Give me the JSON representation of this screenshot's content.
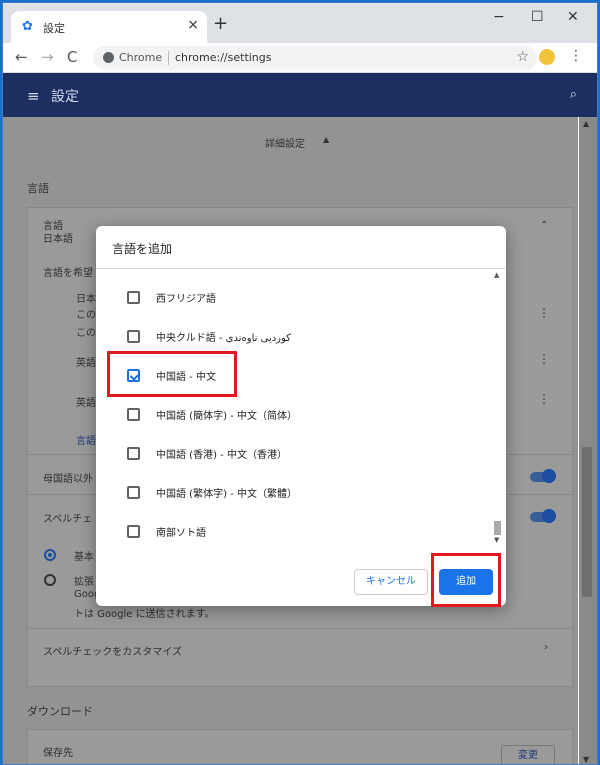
{
  "tab": {
    "title": "設定",
    "close": "×"
  },
  "toolbar": {
    "back": "←",
    "forward": "→",
    "reload": "C",
    "chrome_label": "Chrome",
    "url": "chrome://settings",
    "new_tab": "+",
    "minimize": "−",
    "maximize": "☐",
    "close": "✕"
  },
  "header": {
    "menu_icon": "≡",
    "title": "設定",
    "search_icon": "🔍"
  },
  "settings": {
    "advanced": "詳細設定",
    "advanced_caret": "▲",
    "languages_section": "言語",
    "lang_title": "言語",
    "lang_value": "日本語",
    "order_label": "言語を希望",
    "row1a": "日本",
    "row1b": "この",
    "row1c": "この",
    "row2": "英語",
    "row3": "英語",
    "add_languages": "言語",
    "translate_offer": "母国語以外",
    "spellcheck": "スペルチェ",
    "basic": "基本",
    "enhanced": "拡張",
    "enhanced_desc1": "Googl",
    "enhanced_desc2": "トは Google に送信されます。",
    "customize_spellcheck": "スペルチェックをカスタマイズ",
    "downloads_section": "ダウンロード",
    "save_location": "保存先",
    "change": "変更",
    "chevron": "›",
    "collapse": "⌃"
  },
  "dialog": {
    "title": "言語を追加",
    "languages": [
      {
        "label": "西フリジア語",
        "checked": false
      },
      {
        "label": "中央クルド語 - کوردیی ناوەندی",
        "checked": false
      },
      {
        "label": "中国語 - 中文",
        "checked": true
      },
      {
        "label": "中国語 (簡体字) - 中文（简体）",
        "checked": false
      },
      {
        "label": "中国語 (香港) - 中文（香港）",
        "checked": false
      },
      {
        "label": "中国語 (繁体字) - 中文（繁體）",
        "checked": false
      },
      {
        "label": "南部ソト語",
        "checked": false
      }
    ],
    "cancel": "キャンセル",
    "add": "追加",
    "scroll_up": "▲",
    "scroll_down": "▼"
  },
  "colors": {
    "accent": "#1a73e8",
    "header": "#1c2f60",
    "highlight": "#e0191f",
    "overlay": "#939393"
  }
}
